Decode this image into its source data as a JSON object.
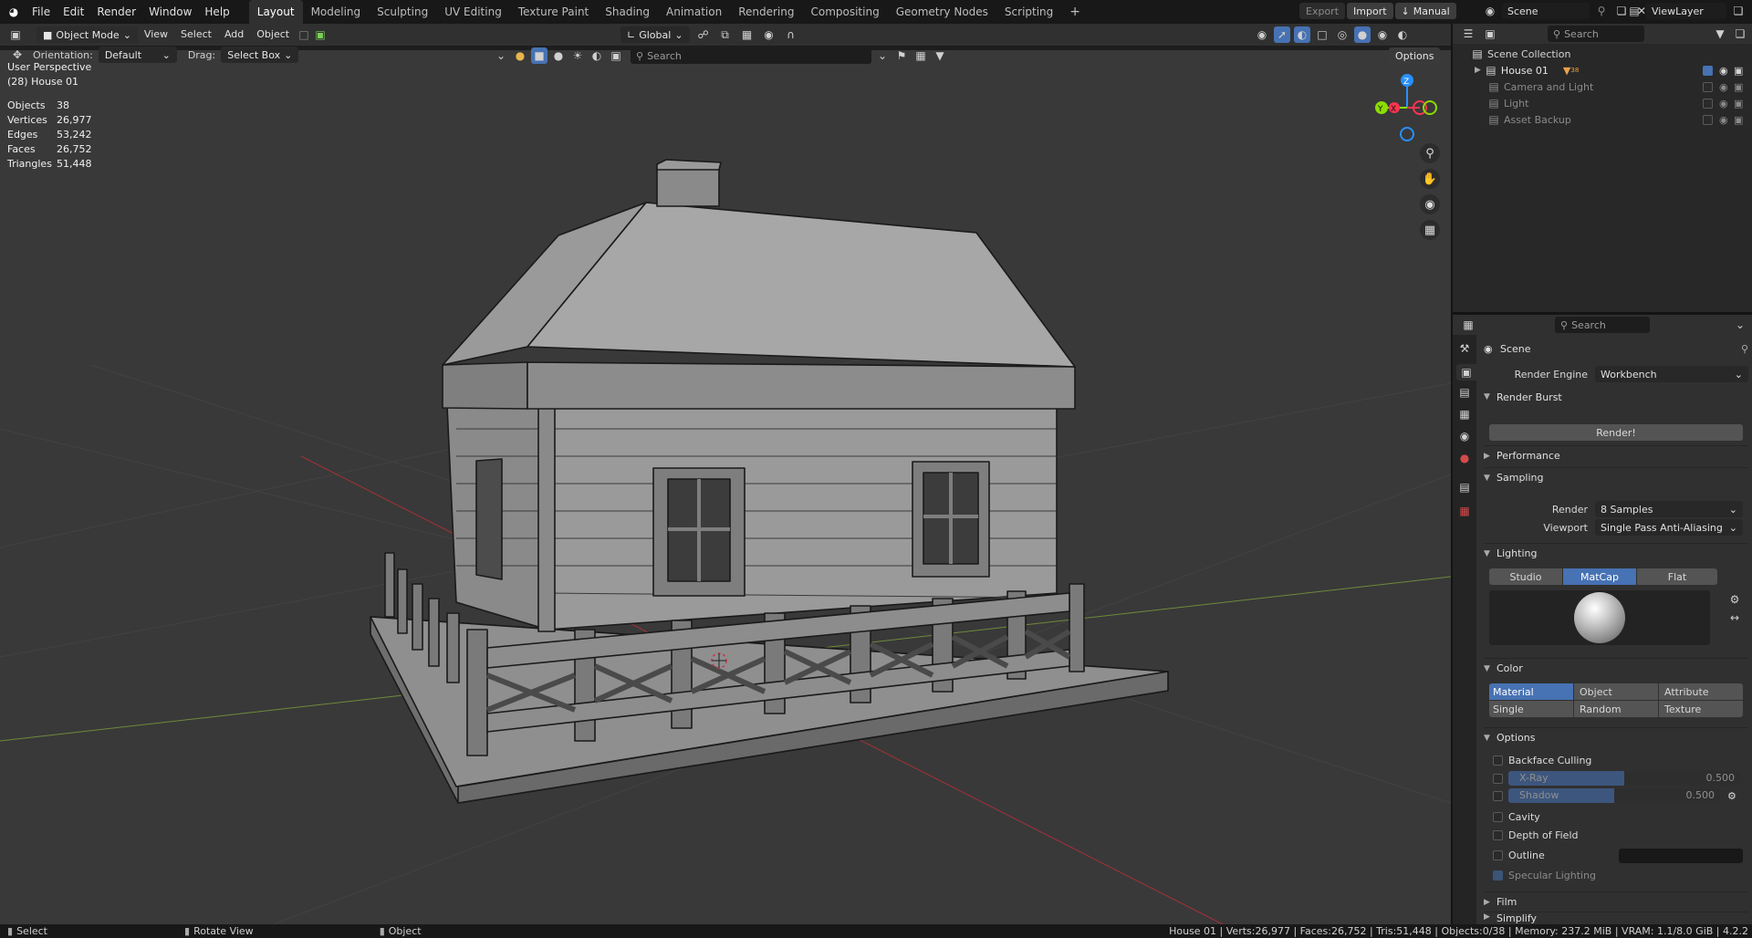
{
  "topbar": {
    "menus": [
      "File",
      "Edit",
      "Render",
      "Window",
      "Help"
    ],
    "workspaces": [
      "Layout",
      "Modeling",
      "Sculpting",
      "UV Editing",
      "Texture Paint",
      "Shading",
      "Animation",
      "Rendering",
      "Compositing",
      "Geometry Nodes",
      "Scripting"
    ],
    "active_workspace": "Layout",
    "add_tab": "+",
    "export_label": "Export",
    "import_label": "Import",
    "manual_label": "Manual",
    "scene_name": "Scene",
    "view_layer": "ViewLayer"
  },
  "viewport_header": {
    "mode": "Object Mode",
    "menus": [
      "View",
      "Select",
      "Add",
      "Object"
    ],
    "orientation_label": "Orientation:",
    "orientation_value": "Default",
    "drag_label": "Drag:",
    "drag_value": "Select Box",
    "transform_orientation": "Global",
    "search_placeholder": "Search",
    "options_label": "Options"
  },
  "overlay": {
    "perspective": "User Perspective",
    "active_object": "(28) House 01",
    "stats": [
      {
        "key": "Objects",
        "value": "38"
      },
      {
        "key": "Vertices",
        "value": "26,977"
      },
      {
        "key": "Edges",
        "value": "53,242"
      },
      {
        "key": "Faces",
        "value": "26,752"
      },
      {
        "key": "Triangles",
        "value": "51,448"
      }
    ],
    "gizmo_axes": {
      "z": "Z",
      "y": "Y",
      "x": "X"
    }
  },
  "outliner": {
    "search_placeholder": "Search",
    "root": "Scene Collection",
    "items": [
      {
        "name": "House 01",
        "count": "38",
        "active": true,
        "checked": true
      },
      {
        "name": "Camera and Light",
        "active": false,
        "checked": false
      },
      {
        "name": "Light",
        "active": false,
        "checked": false
      },
      {
        "name": "Asset Backup",
        "active": false,
        "checked": false
      }
    ]
  },
  "properties": {
    "search_placeholder": "Search",
    "context": "Scene",
    "render_engine_label": "Render Engine",
    "render_engine_value": "Workbench",
    "render_burst": {
      "title": "Render Burst",
      "button": "Render!"
    },
    "performance": "Performance",
    "sampling": {
      "title": "Sampling",
      "render_label": "Render",
      "render_value": "8 Samples",
      "viewport_label": "Viewport",
      "viewport_value": "Single Pass Anti-Aliasing"
    },
    "lighting": {
      "title": "Lighting",
      "modes": [
        "Studio",
        "MatCap",
        "Flat"
      ],
      "active_mode": "MatCap"
    },
    "color": {
      "title": "Color",
      "options": [
        "Material",
        "Object",
        "Attribute",
        "Single",
        "Random",
        "Texture"
      ],
      "active": "Material"
    },
    "options": {
      "title": "Options",
      "backface_culling": "Backface Culling",
      "xray_label": "X-Ray",
      "xray_value": "0.500",
      "shadow_label": "Shadow",
      "shadow_value": "0.500",
      "cavity": "Cavity",
      "depth_of_field": "Depth of Field",
      "outline": "Outline",
      "specular": "Specular Lighting"
    },
    "film": "Film",
    "simplify": "Simplify"
  },
  "statusbar": {
    "select": "Select",
    "rotate": "Rotate View",
    "object": "Object",
    "info": "House 01 | Verts:26,977 | Faces:26,752 | Tris:51,448 | Objects:0/38 | Memory: 237.2 MiB | VRAM: 1.1/8.0 GiB | 4.2.2"
  },
  "colors": {
    "accent": "#4772b3",
    "panel": "#303030",
    "viewport": "#393939",
    "axis_x": "#ff3352",
    "axis_y": "#8bdc00",
    "axis_z": "#2890ff"
  }
}
